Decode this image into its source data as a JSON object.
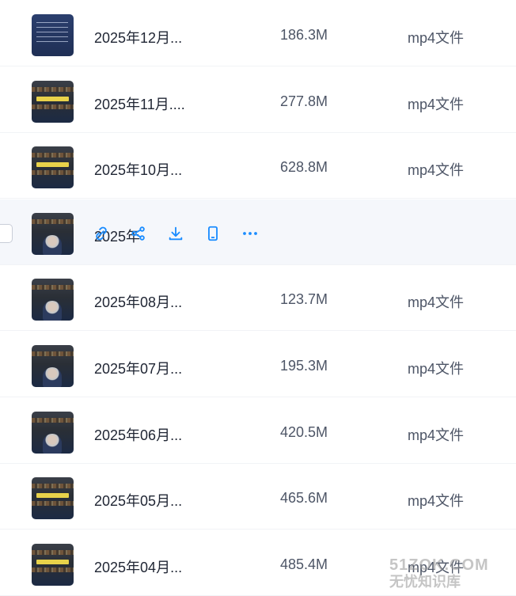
{
  "files": [
    {
      "name": "2025年12月...",
      "size": "186.3M",
      "type": "mp4文件",
      "thumb": "blue"
    },
    {
      "name": "2025年11月....",
      "size": "277.8M",
      "type": "mp4文件",
      "thumb": "library"
    },
    {
      "name": "2025年10月...",
      "size": "628.8M",
      "type": "mp4文件",
      "thumb": "library"
    },
    {
      "name": "2025年",
      "size": "",
      "type": "",
      "thumb": "person",
      "hovered": true
    },
    {
      "name": "2025年08月...",
      "size": "123.7M",
      "type": "mp4文件",
      "thumb": "person"
    },
    {
      "name": "2025年07月...",
      "size": "195.3M",
      "type": "mp4文件",
      "thumb": "person"
    },
    {
      "name": "2025年06月...",
      "size": "420.5M",
      "type": "mp4文件",
      "thumb": "person"
    },
    {
      "name": "2025年05月...",
      "size": "465.6M",
      "type": "mp4文件",
      "thumb": "library"
    },
    {
      "name": "2025年04月...",
      "size": "485.4M",
      "type": "mp4文件",
      "thumb": "library"
    }
  ],
  "hover_actions": [
    {
      "name": "link-icon"
    },
    {
      "name": "share-icon"
    },
    {
      "name": "download-icon"
    },
    {
      "name": "phone-icon"
    },
    {
      "name": "more-icon"
    }
  ],
  "watermark": {
    "line1": "51ZOK.COM",
    "line2": "无忧知识库"
  },
  "colors": {
    "accent": "#1a8cff",
    "hover_bg": "#f5f7fb",
    "text": "#1f2533",
    "muted": "#4d5566"
  }
}
